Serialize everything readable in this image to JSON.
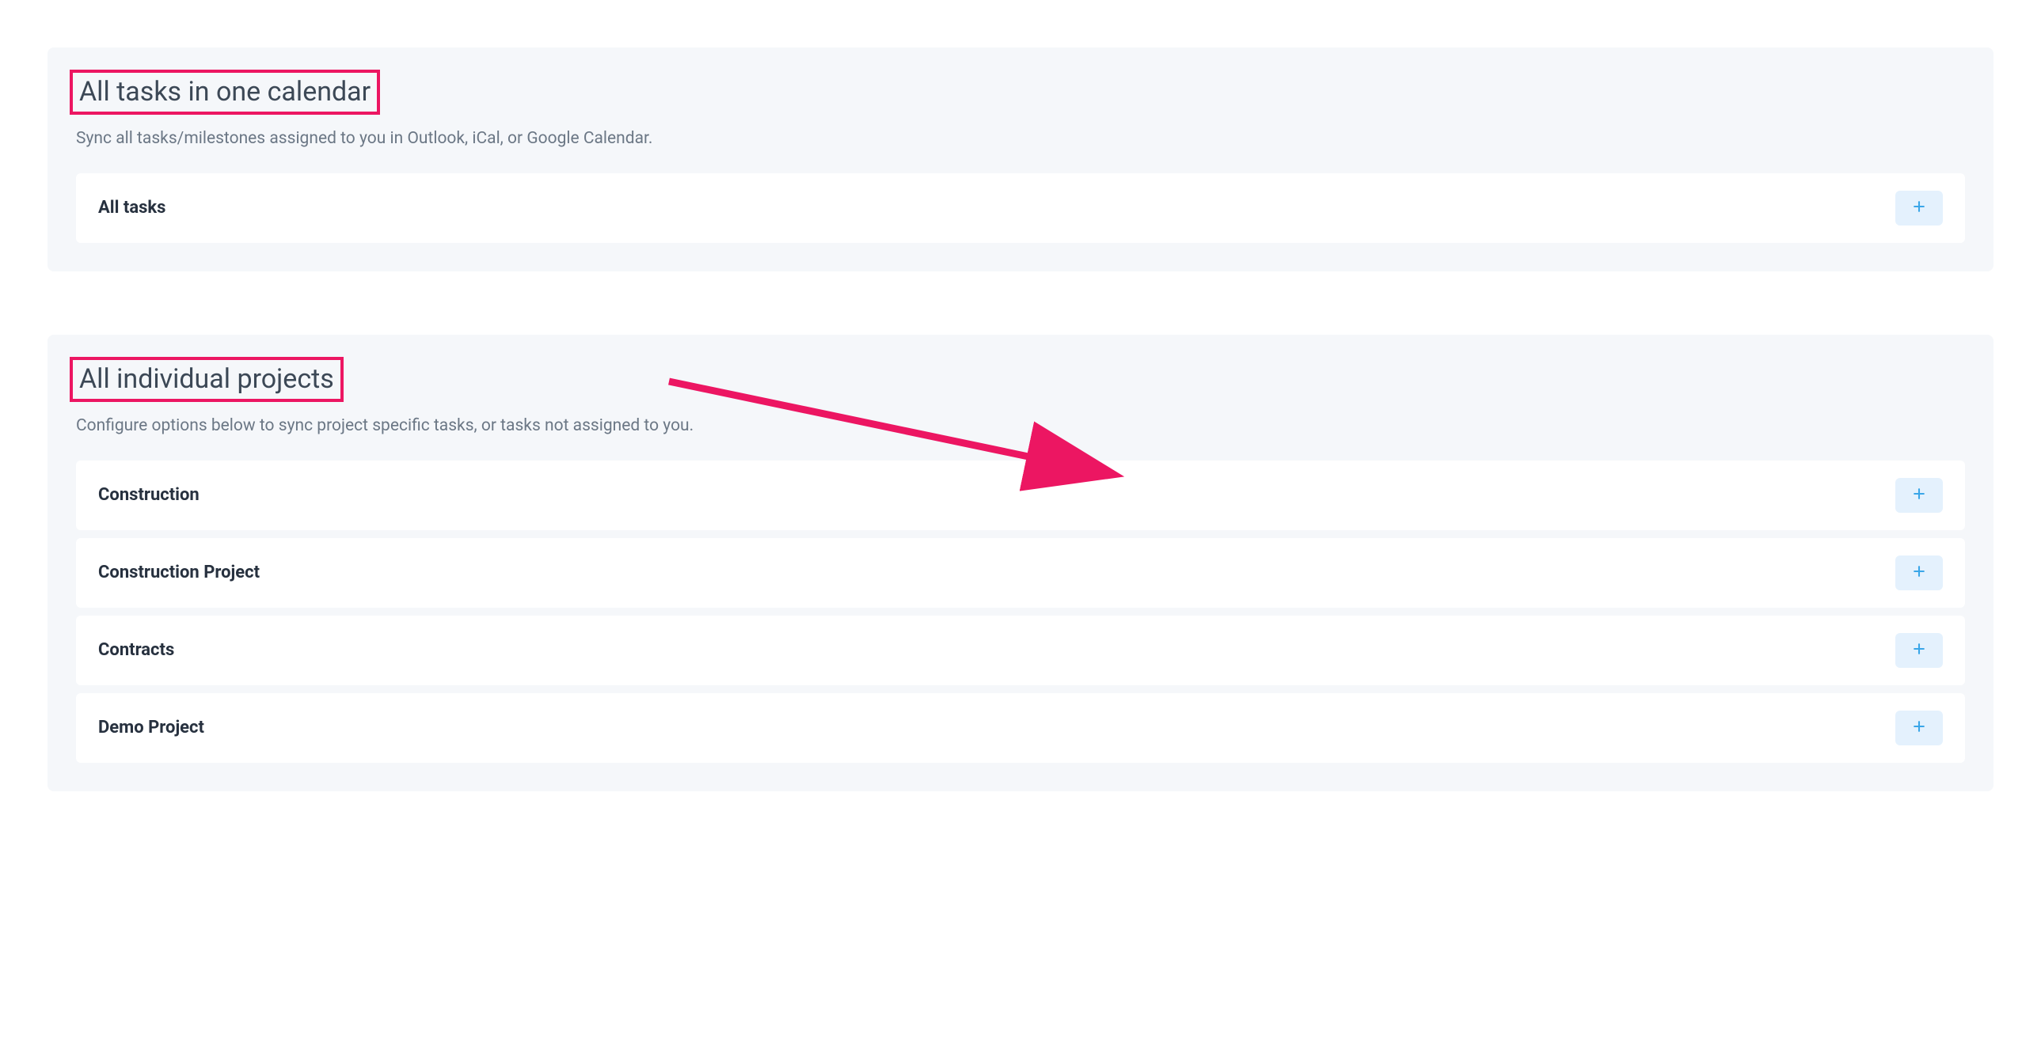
{
  "section1": {
    "title": "All tasks in one calendar",
    "subtitle": "Sync all tasks/milestones assigned to you in Outlook, iCal, or Google Calendar.",
    "rows": [
      {
        "label": "All tasks"
      }
    ]
  },
  "section2": {
    "title": "All individual projects",
    "subtitle": "Configure options below to sync project specific tasks, or tasks not assigned to you.",
    "rows": [
      {
        "label": "Construction"
      },
      {
        "label": "Construction Project"
      },
      {
        "label": "Contracts"
      },
      {
        "label": "Demo Project"
      }
    ]
  },
  "colors": {
    "highlight": "#ec1662",
    "plus_bg": "#e4f1fd",
    "plus_fg": "#3aa6e8"
  }
}
